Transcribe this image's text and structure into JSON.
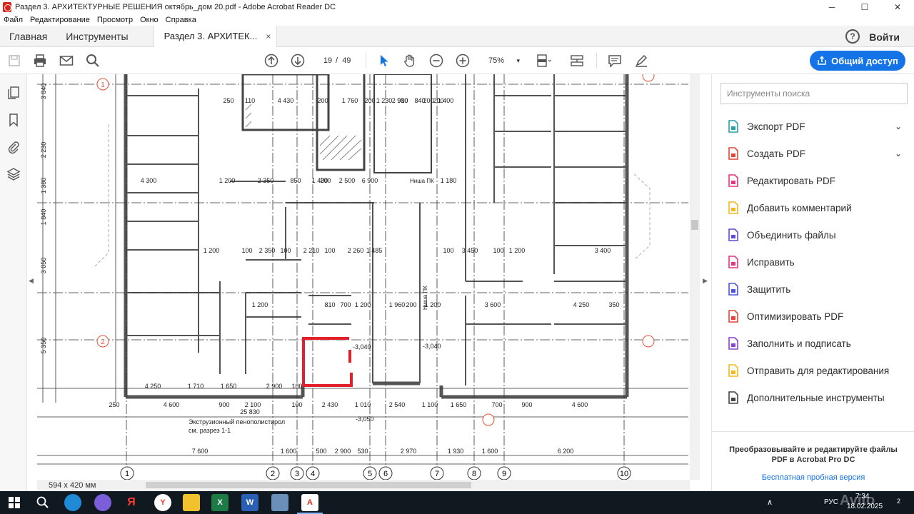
{
  "window": {
    "title": "Раздел 3. АРХИТЕКТУРНЫЕ РЕШЕНИЯ октябрь_дом 20.pdf - Adobe Acrobat Reader DC",
    "controls": [
      "─",
      "☐",
      "✕"
    ]
  },
  "menu": [
    "Файл",
    "Редактирование",
    "Просмотр",
    "Окно",
    "Справка"
  ],
  "tabs": {
    "home": "Главная",
    "tools": "Инструменты",
    "document": "Раздел 3. АРХИТЕК...",
    "close": "×",
    "help": "?",
    "login": "Войти"
  },
  "toolbar": {
    "current_page": "19",
    "page_separator": "/",
    "total_pages": "49",
    "zoom": "75%",
    "share_label": "Общий доступ"
  },
  "drawing": {
    "page_size": "594 x 420 мм",
    "axes_bottom": [
      "1",
      "2",
      "3",
      "4",
      "5",
      "6",
      "7",
      "8",
      "9",
      "10"
    ],
    "axes_left": [
      "1",
      "2"
    ],
    "dims_bottom_row1": [
      "250",
      "4 600",
      "900",
      "2 100",
      "100",
      "2 430",
      "1 010",
      "2 540",
      "1 100",
      "1 650",
      "700",
      "900",
      "4 600"
    ],
    "dims_bottom_row2": [
      "7 600",
      "1 600",
      "500",
      "2 900",
      "530",
      "2 970",
      "1 930",
      "1 600",
      "6 200"
    ],
    "overall": "25 830",
    "level_1": "-3,050",
    "level_2": "-3,040",
    "level_3": "-3,040",
    "note_line1": "Экструзионный пенополистирол",
    "note_line2": "см. разрез 1-1",
    "niche_1": "Ниша ПК",
    "niche_2": "Ниша ПК",
    "dims_left": [
      "3 840",
      "2 230",
      "1 380",
      "1 840",
      "3 050",
      "5 350"
    ],
    "dims_row_a": [
      "4 300",
      "1 200",
      "2 350",
      "850",
      "1 400",
      "200",
      "2 500",
      "6 900",
      "1 180"
    ],
    "dims_row_b": [
      "1 200",
      "100",
      "2 350",
      "100",
      "2 210",
      "100",
      "2 260",
      "1 485",
      "100",
      "3 450",
      "100",
      "1 200",
      "3 400"
    ],
    "dims_row_c": [
      "1 200",
      "810",
      "700",
      "1 200",
      "1 960",
      "200",
      "1 200",
      "3 600",
      "4 250",
      "350"
    ],
    "dims_top": [
      "250",
      "110",
      "4 430",
      "200",
      "1 760",
      "200",
      "2 980",
      "200",
      "1 400",
      "1 230",
      "910",
      "840",
      "200"
    ],
    "dims_bottom_left": [
      "4 250",
      "1 710",
      "1 650",
      "2 900",
      "100"
    ]
  },
  "right_panel": {
    "search_placeholder": "Инструменты поиска",
    "tools": [
      {
        "label": "Экспорт PDF",
        "icon": "export-pdf-icon",
        "color": "#2b9ea8",
        "chevron": "⌄"
      },
      {
        "label": "Создать PDF",
        "icon": "create-pdf-icon",
        "color": "#e0473a",
        "chevron": "⌄"
      },
      {
        "label": "Редактировать PDF",
        "icon": "edit-pdf-icon",
        "color": "#e0357f"
      },
      {
        "label": "Добавить комментарий",
        "icon": "comment-icon",
        "color": "#f2b91d"
      },
      {
        "label": "Объединить файлы",
        "icon": "combine-files-icon",
        "color": "#5b4bd6"
      },
      {
        "label": "Исправить",
        "icon": "fix-icon",
        "color": "#e0357f"
      },
      {
        "label": "Защитить",
        "icon": "protect-icon",
        "color": "#4a55d6"
      },
      {
        "label": "Оптимизировать PDF",
        "icon": "optimize-pdf-icon",
        "color": "#e0473a"
      },
      {
        "label": "Заполнить и подписать",
        "icon": "fill-sign-icon",
        "color": "#8b44c9"
      },
      {
        "label": "Отправить для редактирования",
        "icon": "send-review-icon",
        "color": "#f2b91d"
      },
      {
        "label": "Дополнительные инструменты",
        "icon": "more-tools-icon",
        "color": "#444444"
      }
    ],
    "promo_text": "Преобразовывайте и редактируйте файлы PDF в Acrobat Pro DC",
    "promo_link": "Бесплатная пробная версия"
  },
  "taskbar": {
    "apps": [
      "windows-start-icon",
      "search-icon",
      "edge-icon",
      "viber-icon",
      "yandex-icon",
      "yandex-browser-icon",
      "file-explorer-icon",
      "excel-icon",
      "word-icon",
      "remote-desktop-icon",
      "acrobat-icon"
    ],
    "lang": "РУС",
    "time": "7:34",
    "date": "18.02.2025",
    "notifications": "2",
    "watermark": "Avito"
  }
}
